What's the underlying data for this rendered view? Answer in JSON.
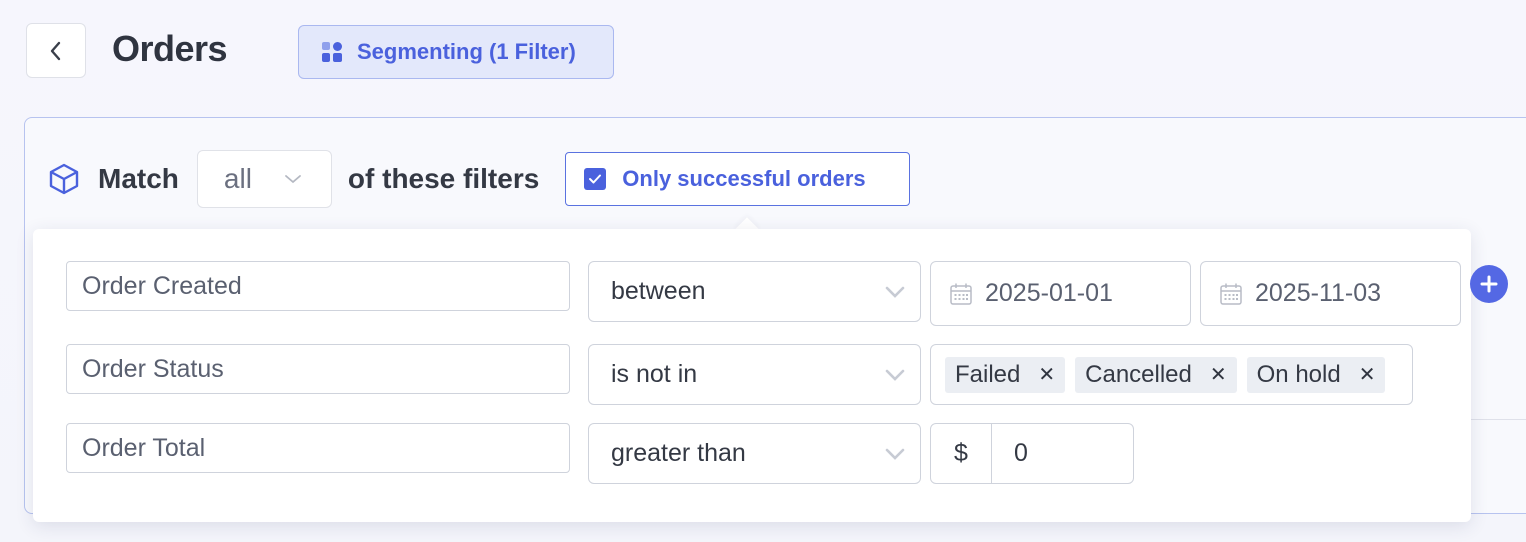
{
  "header": {
    "title": "Orders",
    "segment_button": "Segmenting (1 Filter)"
  },
  "match_row": {
    "prefix": "Match",
    "mode": "all",
    "suffix": "of these filters",
    "only_successful_label": "Only successful orders",
    "only_successful_checked": true
  },
  "filters": [
    {
      "field": "Order Created",
      "operator": "between",
      "date_from": "2025-01-01",
      "date_to": "2025-11-03"
    },
    {
      "field": "Order Status",
      "operator": "is not in",
      "tags": [
        "Failed",
        "Cancelled",
        "On hold"
      ]
    },
    {
      "field": "Order Total",
      "operator": "greater than",
      "currency": "$",
      "amount": "0"
    }
  ],
  "icons": {
    "back": "chevron-left-icon",
    "segment": "grid-icon",
    "match": "cube-icon",
    "calendar": "calendar-icon",
    "add": "plus-icon",
    "remove": "x-icon",
    "dropdown": "chevron-down-icon"
  },
  "colors": {
    "accent": "#4a61dd",
    "accent_light": "#e3e8fb",
    "add_button": "#5468e4"
  }
}
